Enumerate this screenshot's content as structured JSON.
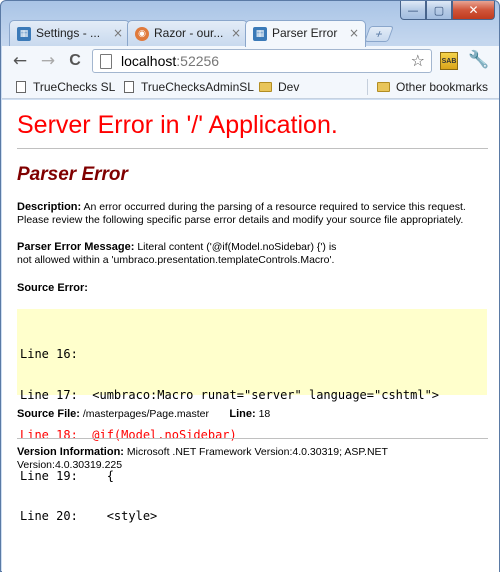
{
  "window": {
    "controls": {
      "minimize": "—",
      "maximize": "▢",
      "close": "✕"
    }
  },
  "tabs": [
    {
      "label": "Settings - ...",
      "favicon": "iis-icon",
      "close": "×"
    },
    {
      "label": "Razor - our...",
      "favicon": "razor-icon",
      "close": "×"
    },
    {
      "label": "Parser Error",
      "favicon": "iis-icon",
      "close": "×",
      "active": true
    }
  ],
  "toolbar": {
    "back": "←",
    "forward": "→",
    "reload": "C",
    "url_host": "localhost",
    "url_port": ":52256",
    "star": "☆",
    "extension_label": "SAB",
    "wrench": "🔧"
  },
  "bookmarks": {
    "items": [
      "TrueChecks SL",
      "TrueChecksAdminSL",
      "Dev"
    ],
    "other": "Other bookmarks"
  },
  "error_page": {
    "title": "Server Error in '/' Application.",
    "subtitle": "Parser Error",
    "description_label": "Description:",
    "description_text": "An error occurred during the parsing of a resource required to service this request. Please review the following specific parse error details and modify your source file appropriately.",
    "message_label": "Parser Error Message:",
    "message_text": "Literal content ('@if(Model.noSidebar) {') is not allowed within a 'umbraco.presentation.templateControls.Macro'.",
    "source_error_label": "Source Error:",
    "code_lines": [
      {
        "text": "Line 16:",
        "error": false
      },
      {
        "text": "Line 17:  <umbraco:Macro runat=\"server\" language=\"cshtml\">",
        "error": false
      },
      {
        "text": "Line 18:  @if(Model.noSidebar)",
        "error": true
      },
      {
        "text": "Line 19:    {",
        "error": false
      },
      {
        "text": "Line 20:    <style>",
        "error": false
      }
    ],
    "source_file_label": "Source File:",
    "source_file": "/masterpages/Page.master",
    "line_label": "Line:",
    "line_number": "18",
    "version_label": "Version Information:",
    "version_text": "Microsoft .NET Framework Version:4.0.30319; ASP.NET Version:4.0.30319.225"
  }
}
